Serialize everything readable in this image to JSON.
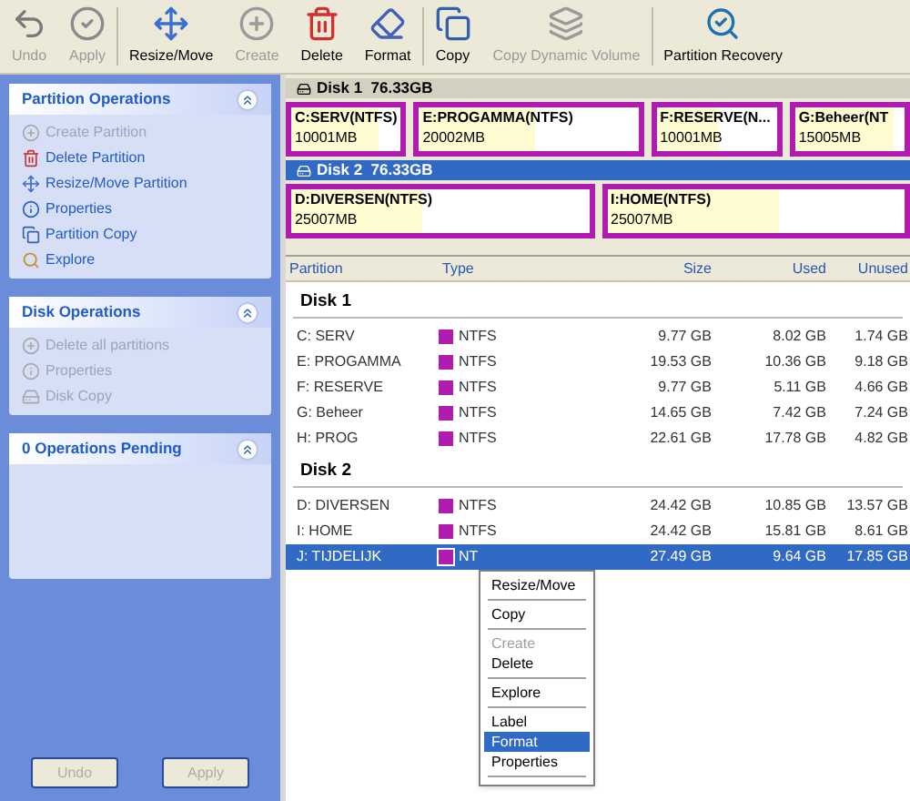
{
  "toolbar": [
    {
      "label": "Undo",
      "disabled": true
    },
    {
      "label": "Apply",
      "disabled": true
    },
    {
      "label": "Resize/Move",
      "disabled": false
    },
    {
      "label": "Create",
      "disabled": true
    },
    {
      "label": "Delete",
      "disabled": false
    },
    {
      "label": "Format",
      "disabled": false
    },
    {
      "label": "Copy",
      "disabled": false
    },
    {
      "label": "Copy Dynamic Volume",
      "disabled": true
    },
    {
      "label": "Partition Recovery",
      "disabled": false
    }
  ],
  "sidebar": [
    {
      "title": "Partition Operations",
      "items": [
        {
          "label": "Create Partition",
          "disabled": true
        },
        {
          "label": "Delete Partition",
          "disabled": false
        },
        {
          "label": "Resize/Move Partition",
          "disabled": false
        },
        {
          "label": "Properties",
          "disabled": false
        },
        {
          "label": "Partition Copy",
          "disabled": false
        },
        {
          "label": "Explore",
          "disabled": false
        }
      ]
    },
    {
      "title": "Disk Operations",
      "items": [
        {
          "label": "Delete all partitions",
          "disabled": true
        },
        {
          "label": "Properties",
          "disabled": true
        },
        {
          "label": "Disk Copy",
          "disabled": true
        }
      ]
    },
    {
      "title": "0 Operations Pending"
    }
  ],
  "sidebar_buttons": [
    {
      "label": "Undo",
      "disabled": true
    },
    {
      "label": "Apply",
      "disabled": true
    }
  ],
  "disk_map": [
    {
      "title": "Disk 1  76.33GB",
      "selected": false,
      "partitions": [
        {
          "name": "C:SERV(NTFS)",
          "size": "10001MB",
          "level": 0.8
        },
        {
          "name": "E:PROGAMMA(NTFS)",
          "size": "20002MB",
          "level": 0.53
        },
        {
          "name": "F:RESERVE(N...",
          "size": "10001MB",
          "level": 0.52
        },
        {
          "name": "G:Beheer(NT",
          "size": "15005MB",
          "level": 0.9
        }
      ]
    },
    {
      "title": "Disk 2  76.33GB",
      "selected": true,
      "partitions": [
        {
          "name": "D:DIVERSEN(NTFS)",
          "size": "25007MB",
          "level": 0.44
        },
        {
          "name": "I:HOME(NTFS)",
          "size": "25007MB",
          "level": 0.58
        }
      ]
    }
  ],
  "table": {
    "columns": [
      "Partition",
      "Type",
      "Size",
      "Used",
      "Unused"
    ],
    "groups": [
      {
        "title": "Disk 1",
        "rows": [
          {
            "partition": "C: SERV",
            "type": "NTFS",
            "color": "#b01cb0",
            "size": "9.77 GB",
            "used": "8.02 GB",
            "unused": "1.74 GB",
            "selected": false
          },
          {
            "partition": "E: PROGAMMA",
            "type": "NTFS",
            "color": "#b01cb0",
            "size": "19.53 GB",
            "used": "10.36 GB",
            "unused": "9.18 GB",
            "selected": false
          },
          {
            "partition": "F: RESERVE",
            "type": "NTFS",
            "color": "#b01cb0",
            "size": "9.77 GB",
            "used": "5.11 GB",
            "unused": "4.66 GB",
            "selected": false
          },
          {
            "partition": "G: Beheer",
            "type": "NTFS",
            "color": "#b01cb0",
            "size": "14.65 GB",
            "used": "7.42 GB",
            "unused": "7.24 GB",
            "selected": false
          },
          {
            "partition": "H: PROG",
            "type": "NTFS",
            "color": "#b01cb0",
            "size": "22.61 GB",
            "used": "17.78 GB",
            "unused": "4.82 GB",
            "selected": false
          }
        ]
      },
      {
        "title": "Disk 2",
        "rows": [
          {
            "partition": "D: DIVERSEN",
            "type": "NTFS",
            "color": "#b01cb0",
            "size": "24.42 GB",
            "used": "10.85 GB",
            "unused": "13.57 GB",
            "selected": false
          },
          {
            "partition": "I: HOME",
            "type": "NTFS",
            "color": "#b01cb0",
            "size": "24.42 GB",
            "used": "15.81 GB",
            "unused": "8.61 GB",
            "selected": false
          },
          {
            "partition": "J: TIJDELIJK",
            "type": "NT",
            "color": "#b01cb0",
            "size": "27.49 GB",
            "used": "9.64 GB",
            "unused": "17.85 GB",
            "selected": true
          }
        ]
      }
    ]
  },
  "context_menu": [
    {
      "kind": "item",
      "label": "Resize/Move",
      "disabled": false,
      "selected": false
    },
    {
      "kind": "separator"
    },
    {
      "kind": "item",
      "label": "Copy",
      "disabled": false,
      "selected": false
    },
    {
      "kind": "separator"
    },
    {
      "kind": "item",
      "label": "Create",
      "disabled": true,
      "selected": false
    },
    {
      "kind": "item",
      "label": "Delete",
      "disabled": false,
      "selected": false
    },
    {
      "kind": "separator"
    },
    {
      "kind": "item",
      "label": "Explore",
      "disabled": false,
      "selected": false
    },
    {
      "kind": "separator"
    },
    {
      "kind": "item",
      "label": "Label",
      "disabled": false,
      "selected": false
    },
    {
      "kind": "item",
      "label": "Format",
      "disabled": false,
      "selected": true
    },
    {
      "kind": "item",
      "label": "Properties",
      "disabled": false,
      "selected": false
    },
    {
      "kind": "separator"
    }
  ]
}
